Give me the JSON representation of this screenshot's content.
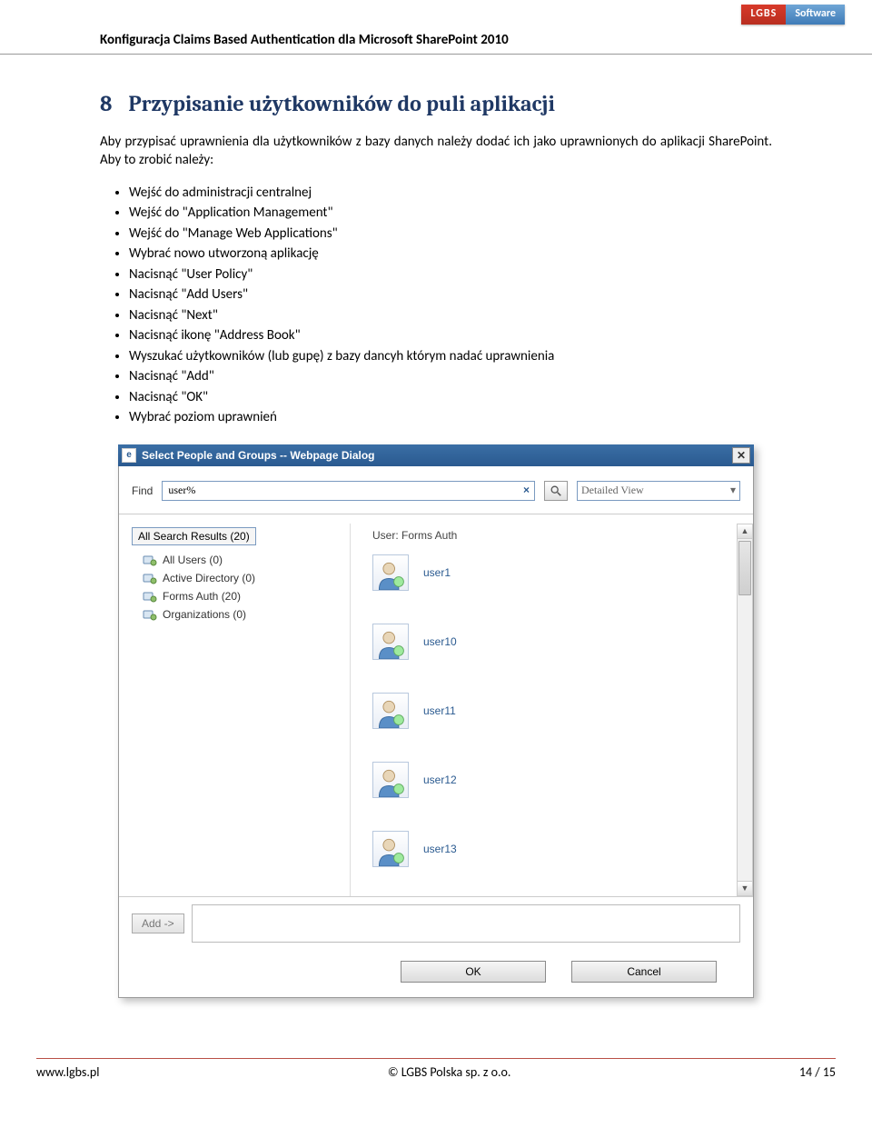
{
  "logo": {
    "left": "LGBS",
    "right": "Software"
  },
  "doc_header": "Konfiguracja Claims Based Authentication dla Microsoft SharePoint 2010",
  "section": {
    "number": "8",
    "title": "Przypisanie użytkowników do puli aplikacji"
  },
  "paragraph": "Aby przypisać uprawnienia dla użytkowników z bazy danych należy dodać ich jako uprawnionych do aplikacji SharePoint. Aby to zrobić należy:",
  "steps": [
    "Wejść do administracji centralnej",
    "Wejść do \"Application Management\"",
    "Wejść do \"Manage Web Applications\"",
    "Wybrać nowo utworzoną aplikację",
    "Nacisnąć \"User Policy\"",
    "Nacisnąć \"Add Users\"",
    "Nacisnąć \"Next\"",
    "Nacisnąć ikonę \"Address Book\"",
    "Wyszukać użytkowników (lub gupę) z bazy dancyh którym nadać uprawnienia",
    "Nacisnąć \"Add\"",
    "Nacisnąć \"OK\"",
    "Wybrać poziom uprawnień"
  ],
  "dialog": {
    "title": "Select People and Groups -- Webpage Dialog",
    "find_label": "Find",
    "find_value": "user%",
    "clear_glyph": "×",
    "view_selected": "Detailed View",
    "tree_root": "All Search Results (20)",
    "tree_items": [
      "All Users (0)",
      "Active Directory (0)",
      "Forms Auth (20)",
      "Organizations (0)"
    ],
    "results_header": "User: Forms Auth",
    "users": [
      "user1",
      "user10",
      "user11",
      "user12",
      "user13"
    ],
    "add_label": "Add ->",
    "ok_label": "OK",
    "cancel_label": "Cancel"
  },
  "footer": {
    "left": "www.lgbs.pl",
    "center": "© LGBS Polska sp. z o.o.",
    "right": "14 / 15"
  }
}
